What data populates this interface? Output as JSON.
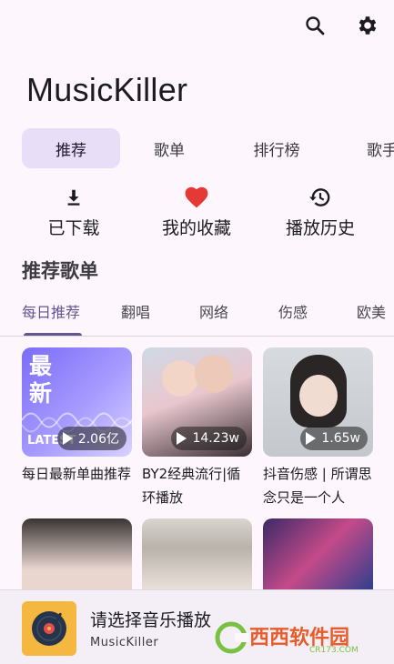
{
  "app": {
    "title": "MusicKiller"
  },
  "topbar": {
    "search_icon": "search-icon",
    "settings_icon": "gear-icon"
  },
  "tabs": [
    {
      "label": "推荐",
      "active": true
    },
    {
      "label": "歌单",
      "active": false
    },
    {
      "label": "排行榜",
      "active": false
    },
    {
      "label": "歌手",
      "active": false
    }
  ],
  "quick_actions": [
    {
      "icon": "download-icon",
      "label": "已下载"
    },
    {
      "icon": "heart-icon",
      "label": "我的收藏",
      "color": "#e53935"
    },
    {
      "icon": "history-icon",
      "label": "播放历史"
    }
  ],
  "section": {
    "title": "推荐歌单"
  },
  "subtabs": [
    {
      "label": "每日推荐",
      "active": true
    },
    {
      "label": "翻唱",
      "active": false
    },
    {
      "label": "网络",
      "active": false
    },
    {
      "label": "伤感",
      "active": false
    },
    {
      "label": "欧美",
      "active": false
    }
  ],
  "playlists": [
    {
      "title": "每日最新单曲推荐",
      "plays": "2.06亿",
      "cover_text": "最新",
      "cover_caption": "LATEST"
    },
    {
      "title": "BY2经典流行|循环播放",
      "plays": "14.23w"
    },
    {
      "title": "抖音伤感 | 所谓思念只是一个人",
      "plays": "1.65w"
    }
  ],
  "now_playing": {
    "title": "请选择音乐播放",
    "subtitle": "MusicKiller"
  },
  "watermark": {
    "text": "西西软件园",
    "sub": "CR173.COM"
  },
  "colors": {
    "accent": "#65558f",
    "active_tab_bg": "#e8def8",
    "background": "#fdf7fd",
    "heart": "#e53935"
  }
}
